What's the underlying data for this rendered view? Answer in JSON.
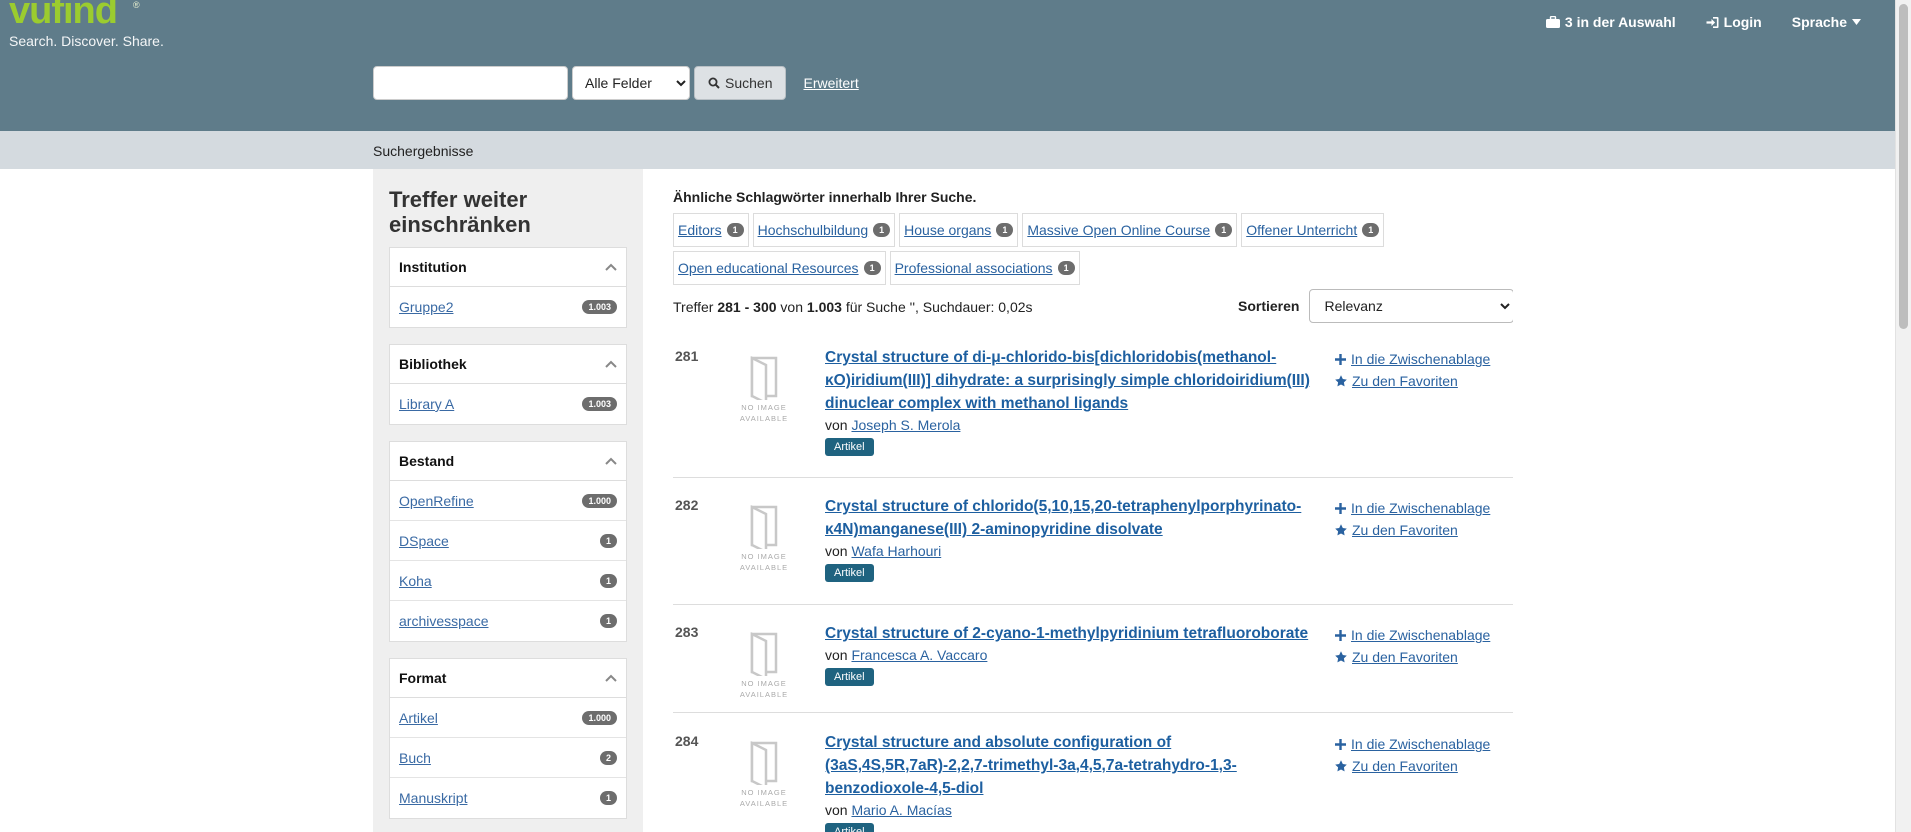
{
  "header": {
    "logo_word": "vufind",
    "logo_reg": "®",
    "tagline": "Search. Discover. Share.",
    "nav": {
      "bookbag": "3 in der Auswahl",
      "login": "Login",
      "language": "Sprache"
    }
  },
  "search": {
    "query": "",
    "type_selected": "Alle Felder",
    "button": "Suchen",
    "advanced": "Erweitert"
  },
  "breadcrumb": "Suchergebnisse",
  "sidebar": {
    "title": "Treffer weiter einschränken",
    "facets": [
      {
        "name": "Institution",
        "items": [
          {
            "label": "Gruppe2",
            "count": "1.003"
          }
        ]
      },
      {
        "name": "Bibliothek",
        "items": [
          {
            "label": "Library A",
            "count": "1.003"
          }
        ]
      },
      {
        "name": "Bestand",
        "items": [
          {
            "label": "OpenRefine",
            "count": "1.000"
          },
          {
            "label": "DSpace",
            "count": "1"
          },
          {
            "label": "Koha",
            "count": "1"
          },
          {
            "label": "archivesspace",
            "count": "1"
          }
        ]
      },
      {
        "name": "Format",
        "items": [
          {
            "label": "Artikel",
            "count": "1.000"
          },
          {
            "label": "Buch",
            "count": "2"
          },
          {
            "label": "Manuskript",
            "count": "1"
          }
        ]
      }
    ]
  },
  "similar": {
    "title": "Ähnliche Schlagwörter innerhalb Ihrer Suche.",
    "tags": [
      {
        "label": "Editors",
        "count": "1"
      },
      {
        "label": "Hochschulbildung",
        "count": "1"
      },
      {
        "label": "House organs",
        "count": "1"
      },
      {
        "label": "Massive Open Online Course",
        "count": "1"
      },
      {
        "label": "Offener Unterricht",
        "count": "1"
      },
      {
        "label": "Open educational Resources",
        "count": "1"
      },
      {
        "label": "Professional associations",
        "count": "1"
      }
    ]
  },
  "stats": {
    "prefix": "Treffer",
    "range": "281 - 300",
    "of": "von",
    "total": "1.003",
    "suffix": "für Suche '', Suchdauer: 0,02s"
  },
  "sort": {
    "label": "Sortieren",
    "selected": "Relevanz"
  },
  "noimage": [
    "NO IMAGE",
    "AVAILABLE"
  ],
  "actions": {
    "cart": "In die Zwischenablage",
    "fav": "Zu den Favoriten"
  },
  "by_label": "von",
  "results": [
    {
      "num": "281",
      "title": "Crystal structure of di-μ-chlorido-bis[dichloridobis(methanol-κO)iridium(III)] dihydrate: a surprisingly simple chloridoiridium(III) dinuclear complex with methanol ligands",
      "author": "Joseph S. Merola",
      "format": "Artikel"
    },
    {
      "num": "282",
      "title": "Crystal structure of chlorido(5,10,15,20-tetraphenylporphyrinato-κ4N)manganese(III) 2-aminopyridine disolvate",
      "author": "Wafa Harhouri",
      "format": "Artikel"
    },
    {
      "num": "283",
      "title": "Crystal structure of 2-cyano-1-methylpyridinium tetrafluoroborate",
      "author": "Francesca A. Vaccaro",
      "format": "Artikel"
    },
    {
      "num": "284",
      "title": "Crystal structure and absolute configuration of (3aS,4S,5R,7aR)-2,2,7-trimethyl-3a,4,5,7a-tetrahydro-1,3-benzodioxole-4,5-diol",
      "author": "Mario A. Macías",
      "format": "Artikel"
    }
  ]
}
